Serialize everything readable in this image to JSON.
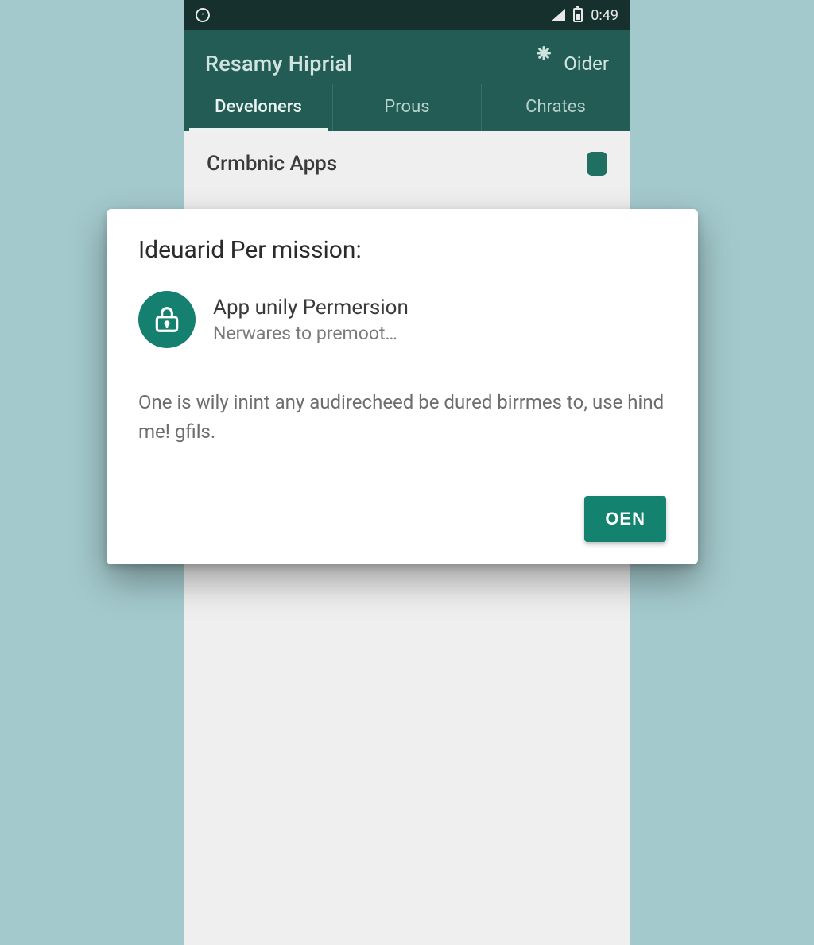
{
  "statusbar": {
    "time": "0:49"
  },
  "appbar": {
    "title": "Resamy Hiprial",
    "action_label": "Oider"
  },
  "tabs": [
    {
      "label": "Develoners",
      "active": true
    },
    {
      "label": "Prous",
      "active": false
    },
    {
      "label": "Chrates",
      "active": false
    }
  ],
  "section": {
    "header": "Crmbnic Apps"
  },
  "dialog": {
    "title": "Ideuarid Per mission:",
    "permission": {
      "name": "App unily Permersion",
      "subtitle": "Nerwares to premoot…"
    },
    "body": "One is wily inint any audirecheed be dured birrmes to, use hind me! gfils.",
    "confirm_label": "OEN"
  },
  "colors": {
    "accent": "#15806f",
    "appbar": "#225c55",
    "background": "#a3c9cc"
  }
}
